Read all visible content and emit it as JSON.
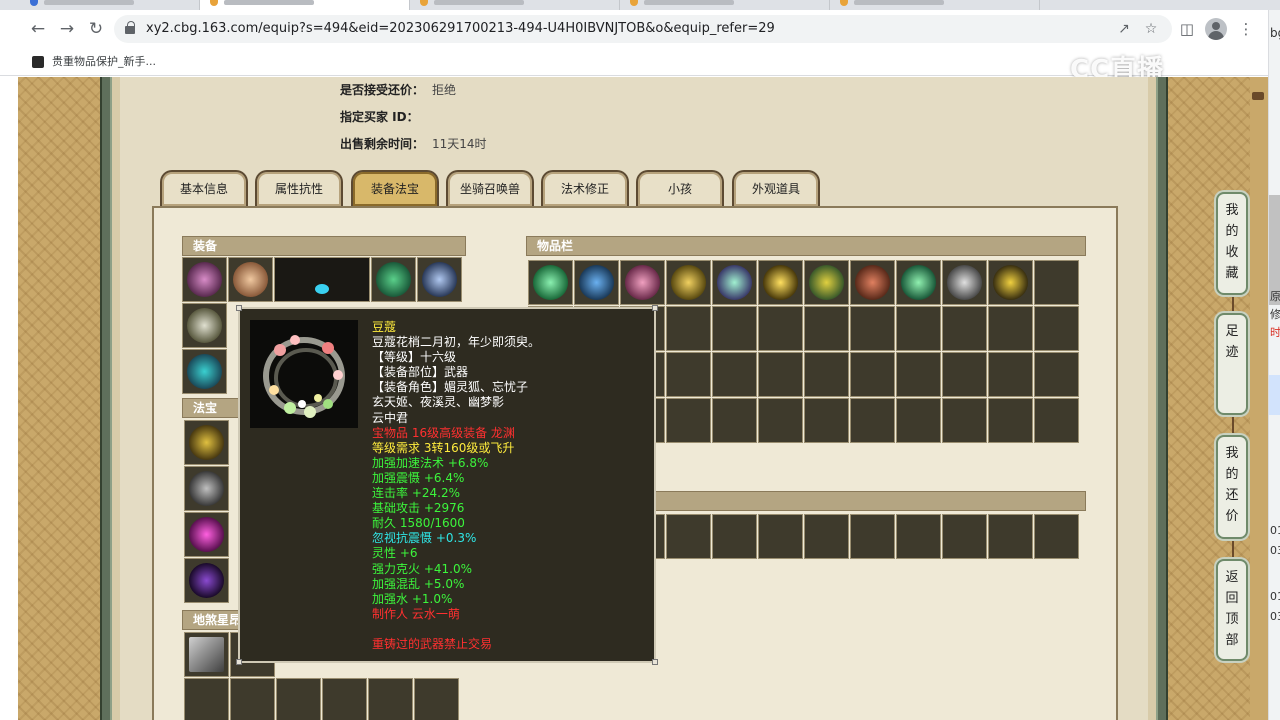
{
  "browser": {
    "url": "xy2.cbg.163.com/equip?s=494&eid=202306291700213-494-U4H0IBVNJTOB&o&equip_refer=29",
    "bookmark_label": "贵重物品保护_新手...",
    "watermark": "CC直播"
  },
  "info": {
    "accept_counter_label": "是否接受还价：",
    "accept_counter_value": "拒绝",
    "buyer_id_label": "指定买家 ID：",
    "buyer_id_value": "",
    "time_left_label": "出售剩余时间：",
    "time_left_value": "11天14时"
  },
  "tabs": [
    "基本信息",
    "属性抗性",
    "装备法宝",
    "坐骑召唤兽",
    "法术修正",
    "小孩",
    "外观道具"
  ],
  "active_tab": "装备法宝",
  "sections": {
    "equipment": "装备",
    "magic_treasure": "法宝",
    "ground_item": "地煞星昂",
    "inventory": "物品栏"
  },
  "tooltip": {
    "lines": [
      {
        "text": "豆蔻",
        "color": "yellow"
      },
      {
        "text": "豆蔻花梢二月初，年少即须臾。",
        "color": "white"
      },
      {
        "text": "【等级】十六级",
        "color": "white"
      },
      {
        "text": "【装备部位】武器",
        "color": "white"
      },
      {
        "text": "【装备角色】媚灵狐、忘忧子",
        "color": "white"
      },
      {
        "text": "玄天姬、夜溪灵、幽梦影",
        "color": "white"
      },
      {
        "text": "云中君",
        "color": "white"
      },
      {
        "text": "宝物品 16级高级装备 龙渊",
        "color": "red"
      },
      {
        "text": "等级需求 3转160级或飞升",
        "color": "yellow"
      },
      {
        "text": "加强加速法术 +6.8%",
        "color": "green"
      },
      {
        "text": "加强震慑 +6.4%",
        "color": "green"
      },
      {
        "text": "连击率 +24.2%",
        "color": "green"
      },
      {
        "text": "基础攻击 +2976",
        "color": "green"
      },
      {
        "text": "耐久 1580/1600",
        "color": "green"
      },
      {
        "text": "忽视抗震慑 +0.3%",
        "color": "cyan"
      },
      {
        "text": "灵性 +6",
        "color": "green"
      },
      {
        "text": "强力克火 +41.0%",
        "color": "green"
      },
      {
        "text": "加强混乱 +5.0%",
        "color": "green"
      },
      {
        "text": "加强水 +1.0%",
        "color": "green"
      },
      {
        "text": "制作人 云水一萌",
        "color": "red"
      },
      {
        "text": "",
        "color": "white"
      },
      {
        "text": "重铸过的武器禁止交易",
        "color": "red"
      }
    ]
  },
  "float_menu": {
    "favorites": "我的收藏",
    "footprints": "足迹",
    "my_offers": "我的还价",
    "back_to_top": "返回顶部"
  },
  "peek_texts": [
    "bg",
    "原",
    "修",
    "时",
    "01",
    "03",
    "01",
    "03"
  ],
  "colors": {
    "page_bg": "#c9a86a",
    "content_bg": "#e4dcc4",
    "section_head": "#b4a582",
    "slot": "#3e3a2c",
    "tooltip_bg": "#2e2b20"
  }
}
